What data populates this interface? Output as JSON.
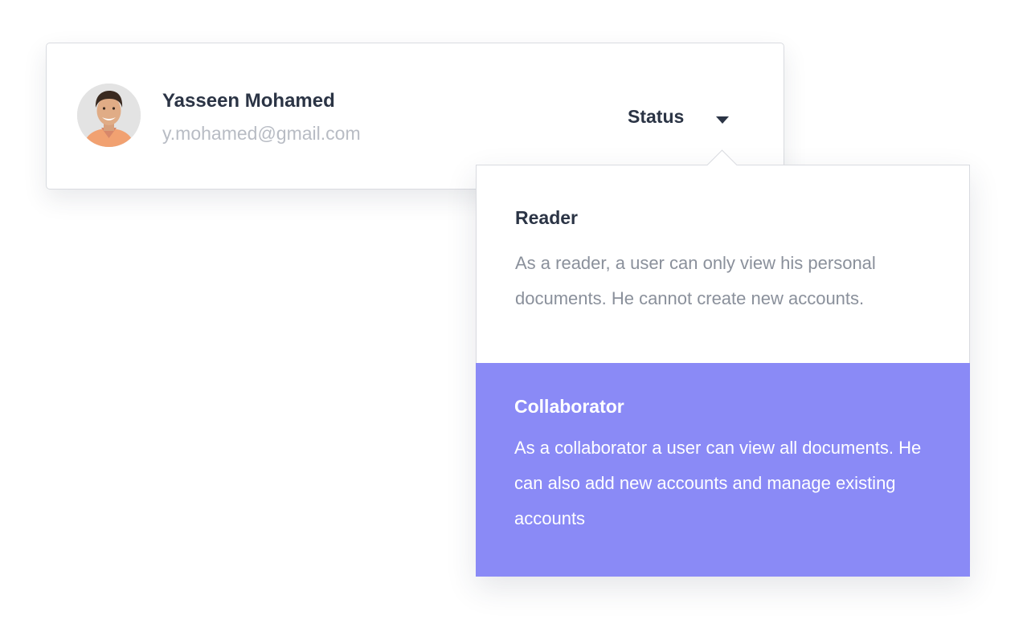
{
  "user": {
    "name": "Yasseen Mohamed",
    "email": "y.mohamed@gmail.com",
    "avatar_icon": "user-photo"
  },
  "status_dropdown": {
    "label": "Status",
    "caret_icon": "caret-down-icon",
    "selected": "Collaborator",
    "options": [
      {
        "title": "Reader",
        "description": "As a reader, a user can only view his personal documents. He cannot create new accounts."
      },
      {
        "title": "Collaborator",
        "description": "As a collaborator a user can view all documents. He can also add new accounts and manage existing accounts"
      }
    ]
  },
  "colors": {
    "accent": "#8a8af6",
    "text_dark": "#2b3445",
    "text_muted": "#8a909b",
    "email": "#b8bcc4",
    "border": "#d9dbe0"
  }
}
